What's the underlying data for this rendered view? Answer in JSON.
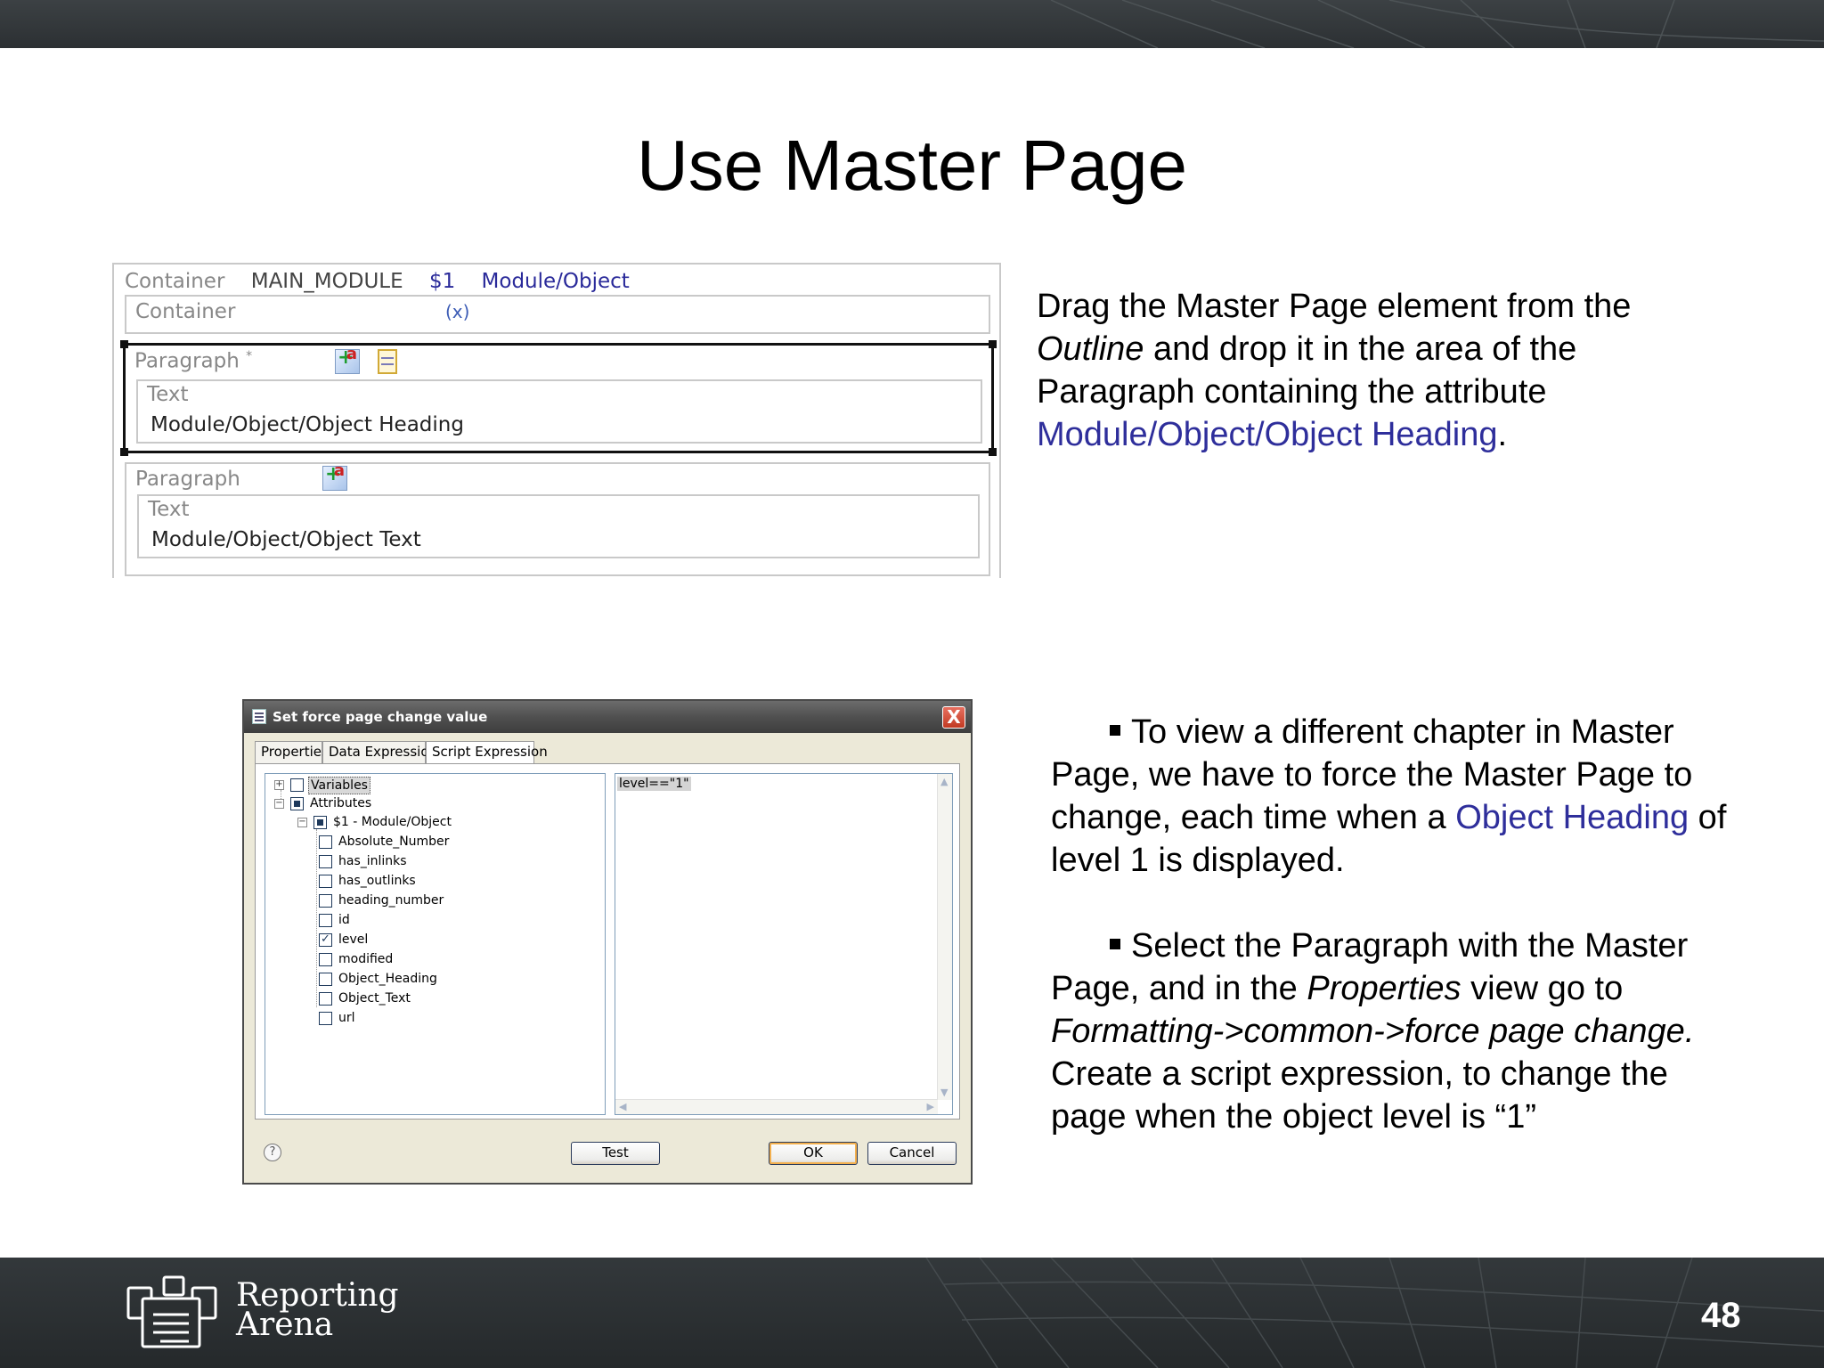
{
  "slide": {
    "title": "Use Master Page",
    "page_number": "48",
    "logo_line1": "Reporting",
    "logo_line2": "Arena"
  },
  "editor": {
    "header": {
      "type": "Container",
      "name": "MAIN_MODULE",
      "var": "$1",
      "source": "Module/Object"
    },
    "container_label": "Container",
    "container_icon": "(x)",
    "paragraph1": {
      "label": "Paragraph",
      "marker": "*",
      "text_label": "Text",
      "text_value": "Module/Object/Object Heading"
    },
    "paragraph2": {
      "label": "Paragraph",
      "text_label": "Text",
      "text_value": "Module/Object/Object Text"
    }
  },
  "instructions": {
    "p1_a": "Drag the Master Page element from the",
    "p1_italic": "Outline",
    "p1_b": " and drop it in the area of the Paragraph containing the attribute ",
    "p1_link": "Module/Object/Object Heading",
    "p1_end": ".",
    "p2_a": "To view a different chapter in Master Page, we have to force the Master Page to change, each time when a ",
    "p2_link": "Object Heading",
    "p2_b": " of level 1 is displayed.",
    "p3_a": "Select the Paragraph with the Master Page, and in the ",
    "p3_italic1": "Properties",
    "p3_b": " view go to ",
    "p3_italic2": "Formatting->common->force page change.",
    "p3_c": " Create a script expression, to change the page when the object level is “1”"
  },
  "dialog": {
    "title": "Set force page change value",
    "close": "X",
    "tabs": [
      "Properties",
      "Data Expression",
      "Script Expression"
    ],
    "active_tab": "Script Expression",
    "tree": {
      "variables": "Variables",
      "attributes": "Attributes",
      "object": "$1 - Module/Object",
      "fields": [
        {
          "label": "Absolute_Number",
          "checked": false
        },
        {
          "label": "has_inlinks",
          "checked": false
        },
        {
          "label": "has_outlinks",
          "checked": false
        },
        {
          "label": "heading_number",
          "checked": false
        },
        {
          "label": "id",
          "checked": false
        },
        {
          "label": "level",
          "checked": true
        },
        {
          "label": "modified",
          "checked": false
        },
        {
          "label": "Object_Heading",
          "checked": false
        },
        {
          "label": "Object_Text",
          "checked": false
        },
        {
          "label": "url",
          "checked": false
        }
      ]
    },
    "script": "level==\"1\"",
    "help": "?",
    "test_button": "Test",
    "ok_button": "OK",
    "cancel_button": "Cancel"
  }
}
